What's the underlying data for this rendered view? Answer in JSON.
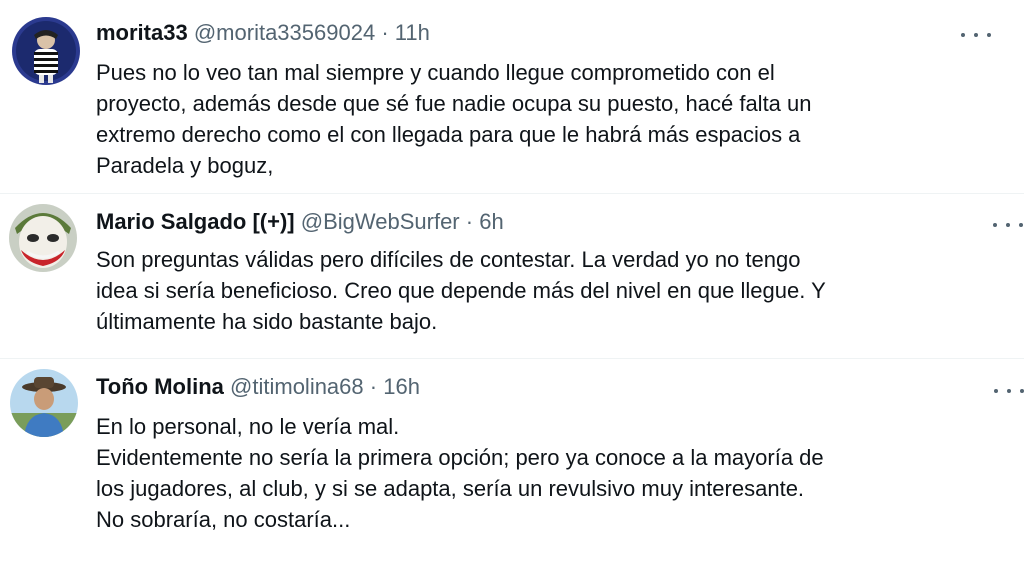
{
  "tweets": [
    {
      "name": "morita33",
      "handle": "@morita33569024",
      "separator": "·",
      "time": "11h",
      "more_icon": "more-horizontal-icon",
      "text_lines": [
        "Pues no lo veo tan mal siempre y cuando llegue comprometido con el",
        "proyecto, además desde que sé fue nadie ocupa su puesto, hacé falta un",
        "extremo derecho como el con llegada para que le habrá más espacios a",
        "Paradela y boguz,"
      ]
    },
    {
      "name": "Mario Salgado [(+)]",
      "handle": "@BigWebSurfer",
      "separator": "·",
      "time": "6h",
      "more_icon": "more-horizontal-icon",
      "text_lines": [
        "Son preguntas válidas pero difíciles de contestar. La verdad yo no tengo",
        "idea si sería beneficioso. Creo que depende más del nivel en que llegue. Y",
        "últimamente ha sido bastante bajo."
      ]
    },
    {
      "name": "Toño Molina",
      "handle": "@titimolina68",
      "separator": "·",
      "time": "16h",
      "more_icon": "more-horizontal-icon",
      "text_lines": [
        "En lo personal, no le vería mal.",
        "Evidentemente no sería la primera opción; pero ya conoce a la mayoría de",
        "los jugadores, al club, y si se adapta, sería un revulsivo muy interesante.",
        "No sobraría, no costaría..."
      ]
    }
  ],
  "colors": {
    "text_primary": "#0f1419",
    "text_secondary": "#536471",
    "divider": "#eff3f4",
    "background": "#ffffff"
  }
}
